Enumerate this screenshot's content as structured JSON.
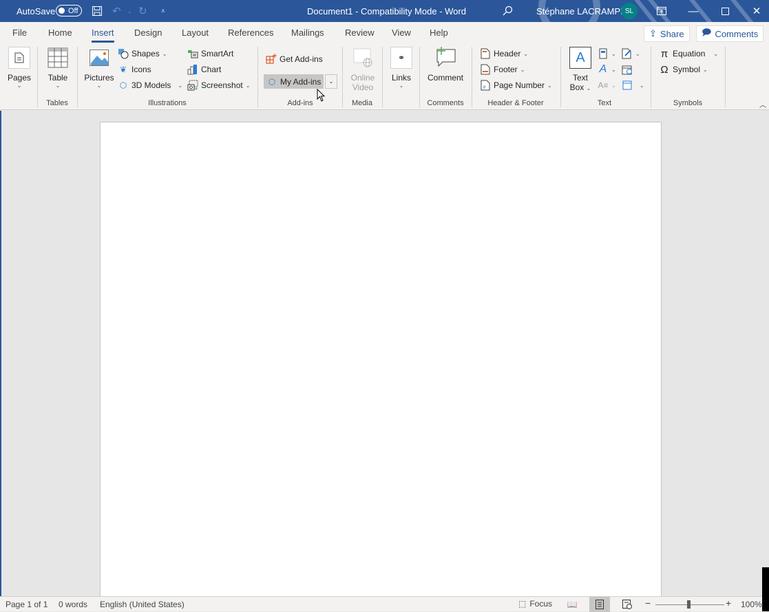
{
  "titlebar": {
    "autosave_label": "AutoSave",
    "autosave_state": "Off",
    "document_title": "Document1  -  Compatibility Mode  -  Word",
    "user_name": "Stéphane LACRAMPE",
    "user_initials": "SL",
    "avatar_color": "#038387",
    "icons": [
      "save-icon",
      "undo-icon",
      "redo-icon",
      "customize-qat-icon",
      "search-icon",
      "ribbon-display-options-icon",
      "minimize-icon",
      "maximize-icon",
      "close-icon"
    ]
  },
  "tabs": [
    {
      "label": "File"
    },
    {
      "label": "Home"
    },
    {
      "label": "Insert",
      "active": true
    },
    {
      "label": "Design"
    },
    {
      "label": "Layout"
    },
    {
      "label": "References"
    },
    {
      "label": "Mailings"
    },
    {
      "label": "Review"
    },
    {
      "label": "View"
    },
    {
      "label": "Help"
    }
  ],
  "header_buttons": {
    "share": "Share",
    "comments": "Comments"
  },
  "ribbon": {
    "pages": {
      "label": "Pages"
    },
    "tables": {
      "table": "Table",
      "group": "Tables"
    },
    "illustrations": {
      "pictures": "Pictures",
      "shapes": "Shapes",
      "icons": "Icons",
      "models3d": "3D Models",
      "smartart": "SmartArt",
      "chart": "Chart",
      "screenshot": "Screenshot",
      "group": "Illustrations"
    },
    "addins": {
      "get": "Get Add-ins",
      "my": "My Add-ins",
      "group": "Add-ins"
    },
    "media": {
      "online": "Online",
      "video": "Video",
      "group": "Media"
    },
    "links": {
      "label": "Links"
    },
    "comments": {
      "comment": "Comment",
      "group": "Comments"
    },
    "header_footer": {
      "header": "Header",
      "footer": "Footer",
      "page_number": "Page Number",
      "group": "Header & Footer"
    },
    "text": {
      "text": "Text",
      "box": "Box",
      "group": "Text"
    },
    "symbols": {
      "equation": "Equation",
      "symbol": "Symbol",
      "group": "Symbols"
    }
  },
  "statusbar": {
    "page": "Page 1 of 1",
    "words": "0 words",
    "language": "English (United States)",
    "focus": "Focus",
    "zoom_minus": "−",
    "zoom_plus": "+",
    "zoom_level": "100%",
    "zoom_percent": 100
  }
}
